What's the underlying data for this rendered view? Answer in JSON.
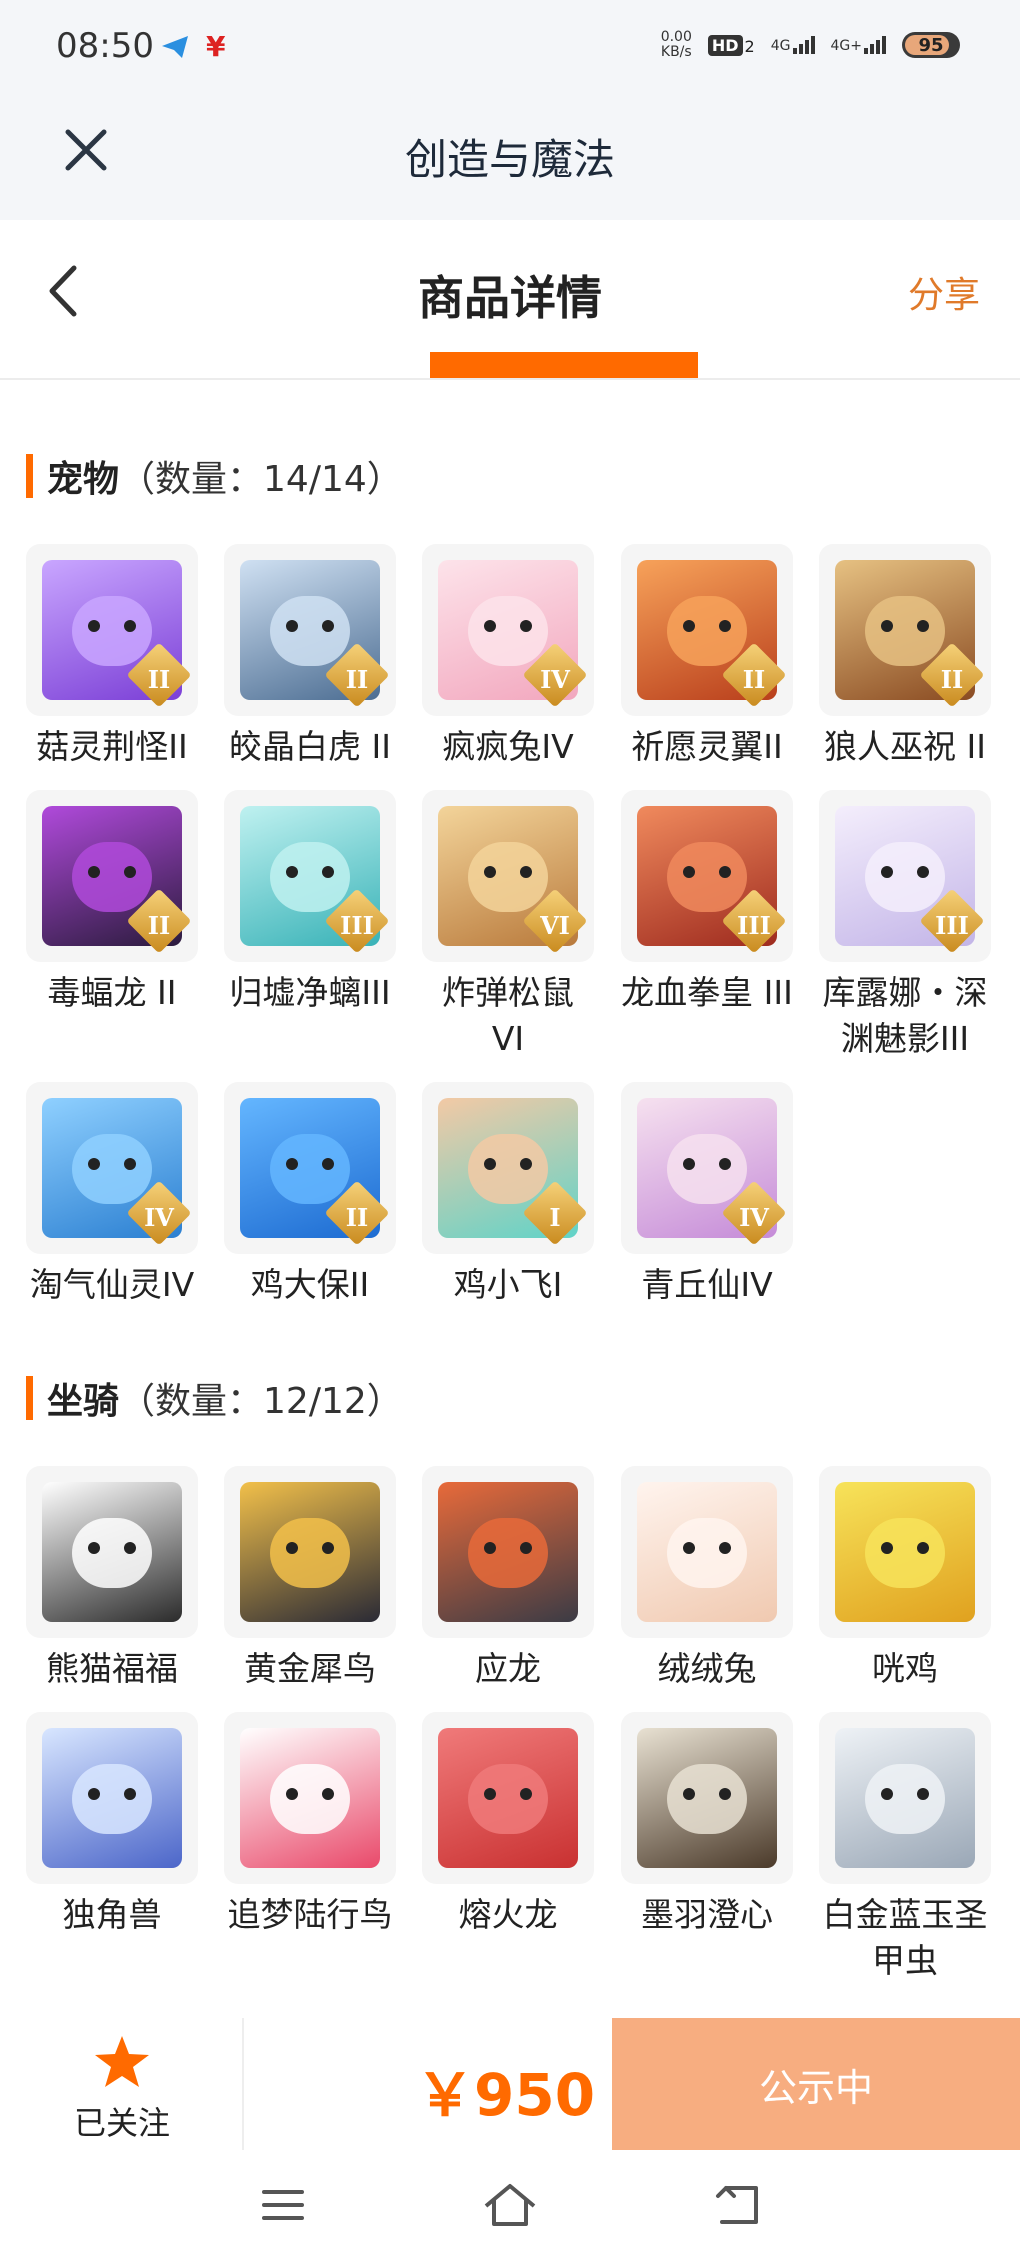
{
  "status_bar": {
    "time": "08:50",
    "net_speed_value": "0.00",
    "net_speed_unit": "KB/s",
    "hd_label": "HD",
    "hd_sub": "2",
    "signal1": "4G",
    "signal2": "4G+",
    "battery": "95"
  },
  "app_bar": {
    "title": "创造与魔法"
  },
  "nav": {
    "title": "商品详情",
    "share": "分享"
  },
  "pets": {
    "name": "宠物",
    "count": "（数量：14/14）",
    "items": [
      {
        "label": "菇灵荆怪II",
        "rank": "II",
        "colors": [
          "#c9a6ff",
          "#7b3fd6"
        ]
      },
      {
        "label": "皎晶白虎 II",
        "rank": "II",
        "colors": [
          "#cfe0f2",
          "#4c6d92"
        ]
      },
      {
        "label": "疯疯兔IV",
        "rank": "IV",
        "colors": [
          "#fde3ea",
          "#f2a7be"
        ]
      },
      {
        "label": "祈愿灵翼II",
        "rank": "II",
        "colors": [
          "#f7a25a",
          "#b93f1c"
        ]
      },
      {
        "label": "狼人巫祝 II",
        "rank": "II",
        "colors": [
          "#e6c182",
          "#8a4b22"
        ]
      },
      {
        "label": "毒蝠龙 II",
        "rank": "II",
        "colors": [
          "#b04adb",
          "#2b1b3d"
        ]
      },
      {
        "label": "归墟净螭III",
        "rank": "III",
        "colors": [
          "#bff1f0",
          "#38b2b7"
        ]
      },
      {
        "label": "炸弹松鼠 VI",
        "rank": "VI",
        "colors": [
          "#f3d49a",
          "#b97a3c"
        ]
      },
      {
        "label": "龙血拳皇 III",
        "rank": "III",
        "colors": [
          "#f08a5d",
          "#9e2b1f"
        ]
      },
      {
        "label": "库露娜・深渊魅影III",
        "rank": "III",
        "colors": [
          "#f4eefc",
          "#c3b5e8"
        ]
      },
      {
        "label": "淘气仙灵IV",
        "rank": "IV",
        "colors": [
          "#8fd0ff",
          "#2b7fd1"
        ]
      },
      {
        "label": "鸡大保II",
        "rank": "II",
        "colors": [
          "#64b6ff",
          "#1d6bd1"
        ]
      },
      {
        "label": "鸡小飞I",
        "rank": "I",
        "colors": [
          "#f3c9a5",
          "#60d3c8"
        ]
      },
      {
        "label": "青丘仙IV",
        "rank": "IV",
        "colors": [
          "#f6e1ef",
          "#c58bd8"
        ]
      }
    ]
  },
  "mounts": {
    "name": "坐骑",
    "count": "（数量：12/12）",
    "items": [
      {
        "label": "熊猫福福",
        "colors": [
          "#ffffff",
          "#2b2b2b"
        ]
      },
      {
        "label": "黄金犀鸟",
        "colors": [
          "#f2c04a",
          "#2a2a35"
        ]
      },
      {
        "label": "应龙",
        "colors": [
          "#e86a3a",
          "#3b3b45"
        ]
      },
      {
        "label": "绒绒兔",
        "colors": [
          "#fff4ee",
          "#f0c9b0"
        ]
      },
      {
        "label": "咣鸡",
        "colors": [
          "#f7e35a",
          "#e0a11f"
        ]
      },
      {
        "label": "独角兽",
        "colors": [
          "#d8e6ff",
          "#4c66c9"
        ]
      },
      {
        "label": "追梦陆行鸟",
        "colors": [
          "#ffffff",
          "#e9496a"
        ]
      },
      {
        "label": "熔火龙",
        "colors": [
          "#f07a7a",
          "#c93131"
        ]
      },
      {
        "label": "墨羽澄心",
        "colors": [
          "#e8e1d2",
          "#4b3a2a"
        ]
      },
      {
        "label": "白金蓝玉圣甲虫",
        "colors": [
          "#eef2f6",
          "#9aa7b6"
        ]
      }
    ]
  },
  "bottom": {
    "follow_label": "已关注",
    "price": "￥950",
    "status_label": "公示中"
  },
  "colors": {
    "accent": "#ff6a00",
    "button_bg": "#f7ad80",
    "share": "#e07a2a"
  }
}
